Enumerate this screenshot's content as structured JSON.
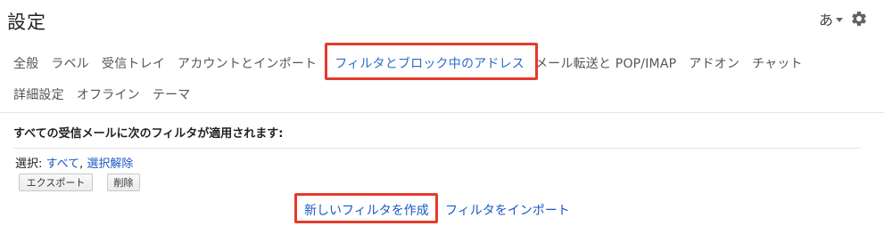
{
  "header": {
    "title": "設定",
    "input_tool": "あ",
    "settings_icon": "gear-icon"
  },
  "tabs": {
    "row1": [
      {
        "label": "全般"
      },
      {
        "label": "ラベル"
      },
      {
        "label": "受信トレイ"
      },
      {
        "label": "アカウントとインポート"
      },
      {
        "label": "フィルタとブロック中のアドレス",
        "active": true
      },
      {
        "label": "メール転送と POP/IMAP"
      },
      {
        "label": "アドオン"
      },
      {
        "label": "チャット"
      }
    ],
    "row2": [
      {
        "label": "詳細設定"
      },
      {
        "label": "オフライン"
      },
      {
        "label": "テーマ"
      }
    ]
  },
  "filters": {
    "heading": "すべての受信メールに次のフィルタが適用されます:",
    "select_label": "選択:",
    "select_all": "すべて",
    "separator": ",",
    "deselect": "選択解除",
    "export_button": "エクスポート",
    "delete_button": "削除",
    "create_link": "新しいフィルタを作成",
    "import_link": "フィルタをインポート"
  },
  "colors": {
    "accent": "#2a6bcc",
    "link": "#1a57c4",
    "highlight": "#e53a2b"
  }
}
